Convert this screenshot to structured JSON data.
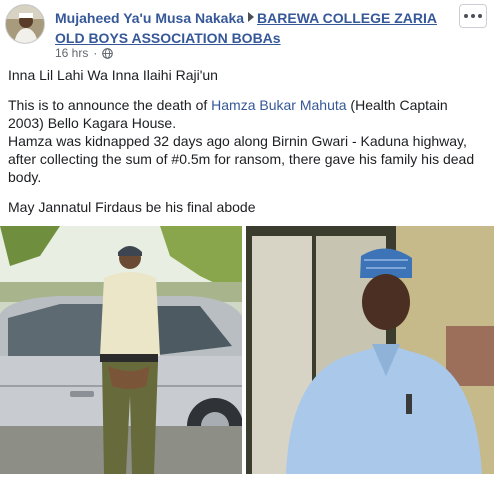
{
  "post": {
    "author": "Mujaheed Ya'u Musa Nakaka",
    "group": "BAREWA COLLEGE ZARIA OLD BOYS ASSOCIATION BOBAs",
    "time": "16 hrs",
    "time_separator": "·",
    "privacy_icon": "globe-icon",
    "more_icon": "more-options-icon"
  },
  "body": {
    "line1": "Inna Lil Lahi Wa Inna Ilaihi Raji'un",
    "line2_prefix": "This is to announce the death of ",
    "line2_mention": "Hamza Bukar Mahuta",
    "line2_suffix": " (Health Captain 2003) Bello Kagara House.",
    "line3": "Hamza was kidnapped 32 days ago along Birnin Gwari - Kaduna highway, after collecting the sum of #0.5m for ransom, there gave his family his dead body.",
    "line4": "May Jannatul Firdaus be his final abode"
  },
  "colors": {
    "link": "#365899",
    "text": "#1c1e21",
    "meta": "#616770"
  }
}
